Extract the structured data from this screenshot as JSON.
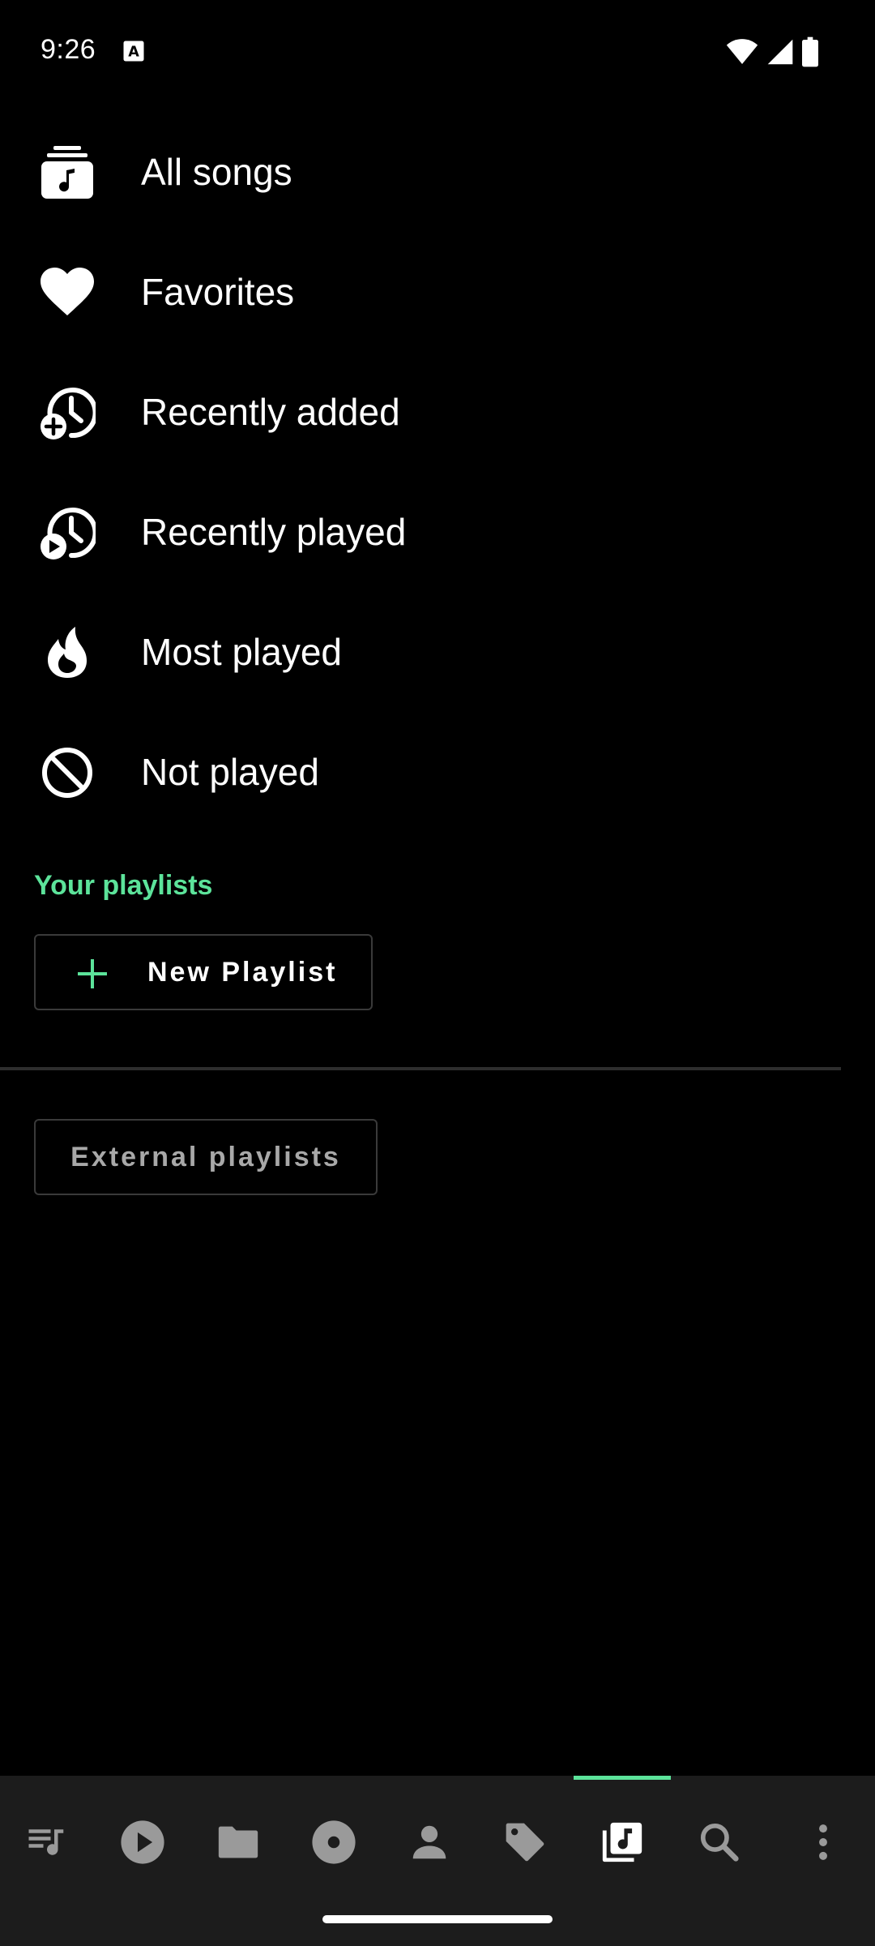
{
  "status_bar": {
    "time": "9:26",
    "icons": [
      "notification-a-icon",
      "wifi-icon",
      "signal-icon",
      "battery-icon"
    ]
  },
  "menu": {
    "items": [
      {
        "label": "All songs",
        "icon": "all-songs-icon"
      },
      {
        "label": "Favorites",
        "icon": "heart-icon"
      },
      {
        "label": "Recently added",
        "icon": "recently-added-icon"
      },
      {
        "label": "Recently played",
        "icon": "recently-played-icon"
      },
      {
        "label": "Most played",
        "icon": "flame-icon"
      },
      {
        "label": "Not played",
        "icon": "block-icon"
      }
    ]
  },
  "playlists": {
    "section_title": "Your playlists",
    "new_playlist_label": "New Playlist",
    "external_label": "External playlists"
  },
  "bottom_nav": {
    "items": [
      {
        "icon": "queue-icon"
      },
      {
        "icon": "play-icon"
      },
      {
        "icon": "folder-icon"
      },
      {
        "icon": "album-icon"
      },
      {
        "icon": "artist-icon"
      },
      {
        "icon": "tag-icon"
      },
      {
        "icon": "playlist-icon",
        "selected": true
      },
      {
        "icon": "search-icon"
      },
      {
        "icon": "more-icon"
      }
    ]
  },
  "colors": {
    "accent": "#5ce39a",
    "background": "#000000",
    "nav_background": "#1c1c1c",
    "nav_icon": "#9a9a9a"
  }
}
